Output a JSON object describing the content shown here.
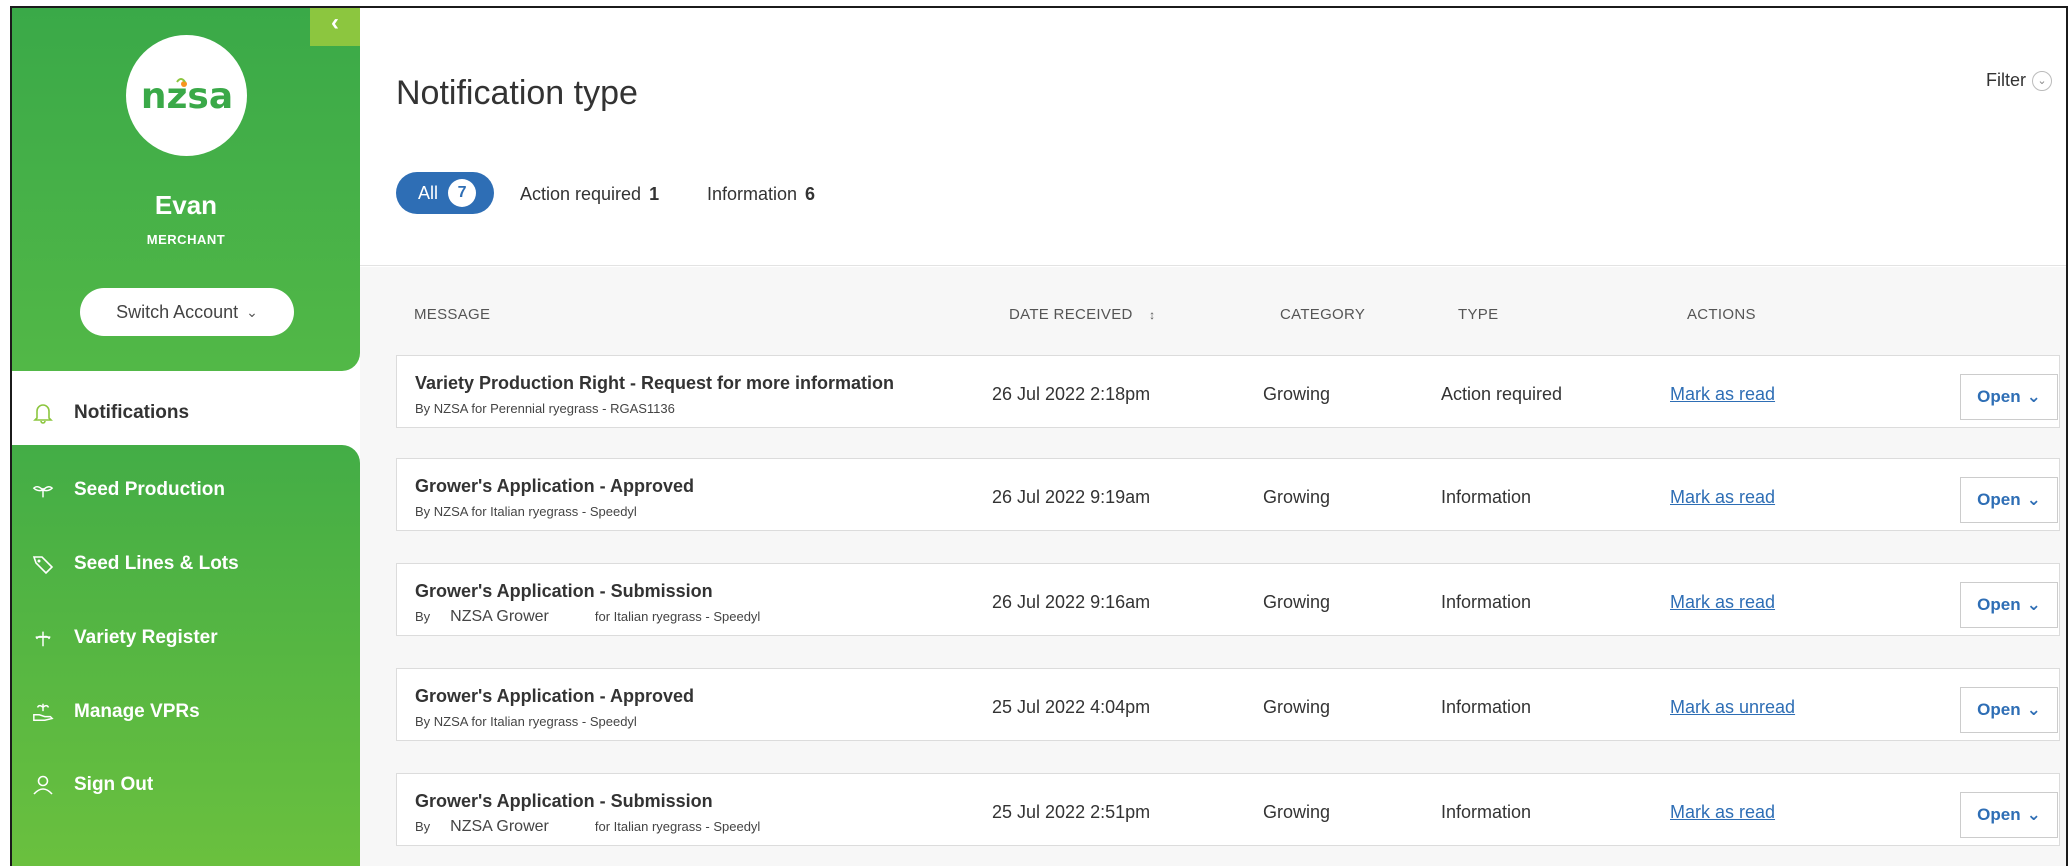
{
  "sidebar": {
    "collapse_icon": "chevron-left-icon",
    "logo_text": "nzsa",
    "user_name": "Evan",
    "user_role": "MERCHANT",
    "switch_account_label": "Switch Account",
    "active_item": {
      "label": "Notifications",
      "icon": "bell-icon"
    },
    "items": [
      {
        "label": "Seed Production",
        "icon": "sprout-icon"
      },
      {
        "label": "Seed Lines & Lots",
        "icon": "tag-icon"
      },
      {
        "label": "Variety Register",
        "icon": "plant-icon"
      },
      {
        "label": "Manage VPRs",
        "icon": "hand-plant-icon"
      },
      {
        "label": "Sign Out",
        "icon": "user-icon"
      }
    ]
  },
  "header": {
    "title": "Notification type",
    "filter_label": "Filter",
    "tabs": [
      {
        "label": "All",
        "count": "7"
      },
      {
        "label": "Action required",
        "count": "1"
      },
      {
        "label": "Information",
        "count": "6"
      }
    ]
  },
  "table": {
    "columns": [
      "MESSAGE",
      "DATE RECEIVED",
      "CATEGORY",
      "TYPE",
      "ACTIONS"
    ],
    "sort_icon": "↕",
    "open_label": "Open",
    "rows": [
      {
        "title": "Variety Production Right - Request for more information",
        "by": "By NZSA for Perennial ryegrass - RGAS1136",
        "date": "26 Jul 2022 2:18pm",
        "category": "Growing",
        "type": "Action required",
        "action": "Mark as read"
      },
      {
        "title": "Grower's Application - Approved",
        "by": "By NZSA for Italian ryegrass - Speedyl",
        "date": "26 Jul 2022 9:19am",
        "category": "Growing",
        "type": "Information",
        "action": "Mark as read"
      },
      {
        "title": "Grower's Application - Submission",
        "by_prefix": "By",
        "by_name": "NZSA Grower",
        "by_suffix": "for Italian ryegrass - Speedyl",
        "date": "26 Jul 2022 9:16am",
        "category": "Growing",
        "type": "Information",
        "action": "Mark as read"
      },
      {
        "title": "Grower's Application - Approved",
        "by": "By NZSA for Italian ryegrass - Speedyl",
        "date": "25 Jul 2022 4:04pm",
        "category": "Growing",
        "type": "Information",
        "action": "Mark as unread"
      },
      {
        "title": "Grower's Application - Submission",
        "by_prefix": "By",
        "by_name": "NZSA Grower",
        "by_suffix": "for Italian ryegrass - Speedyl",
        "date": "25 Jul 2022 2:51pm",
        "category": "Growing",
        "type": "Information",
        "action": "Mark as read"
      }
    ]
  }
}
